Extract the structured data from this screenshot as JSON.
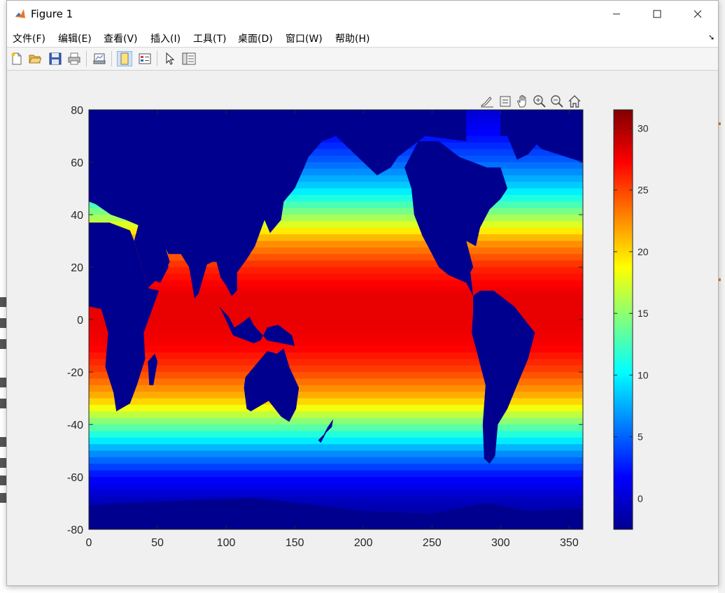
{
  "window": {
    "title": "Figure 1",
    "menus": [
      "文件(F)",
      "编辑(E)",
      "查看(V)",
      "插入(I)",
      "工具(T)",
      "桌面(D)",
      "窗口(W)",
      "帮助(H)"
    ]
  },
  "toolbar_icons": [
    "new-figure-icon",
    "open-icon",
    "save-icon",
    "print-icon",
    "link-plot-icon",
    "dock-icon",
    "insert-legend-icon",
    "select-arrow-icon",
    "property-editor-icon"
  ],
  "axes_toolbar_icons": [
    "brush-icon",
    "data-tip-icon",
    "pan-icon",
    "zoom-in-icon",
    "zoom-out-icon",
    "home-icon"
  ],
  "chart_data": {
    "type": "heatmap",
    "description_colormap": "jet",
    "xlim": [
      0,
      360
    ],
    "ylim": [
      -80,
      80
    ],
    "x_ticks": [
      "0",
      "50",
      "100",
      "150",
      "200",
      "250",
      "300",
      "350"
    ],
    "y_ticks": [
      "80",
      "60",
      "40",
      "20",
      "0",
      "-20",
      "-40",
      "-60",
      "-80"
    ],
    "colorbar": {
      "clim": [
        -2.5,
        31.5
      ],
      "ticks": [
        "30",
        "25",
        "20",
        "15",
        "10",
        "5",
        "0"
      ]
    },
    "land_color": "#00008f",
    "zonal_profile_lat": [
      -80,
      -70,
      -60,
      -50,
      -40,
      -30,
      -20,
      -10,
      0,
      10,
      20,
      30,
      40,
      50,
      60,
      70,
      80
    ],
    "zonal_profile_value": [
      -2,
      -1,
      2,
      7,
      14,
      21,
      25,
      27.5,
      28,
      28,
      26,
      22,
      15,
      9,
      5,
      2,
      0
    ]
  }
}
